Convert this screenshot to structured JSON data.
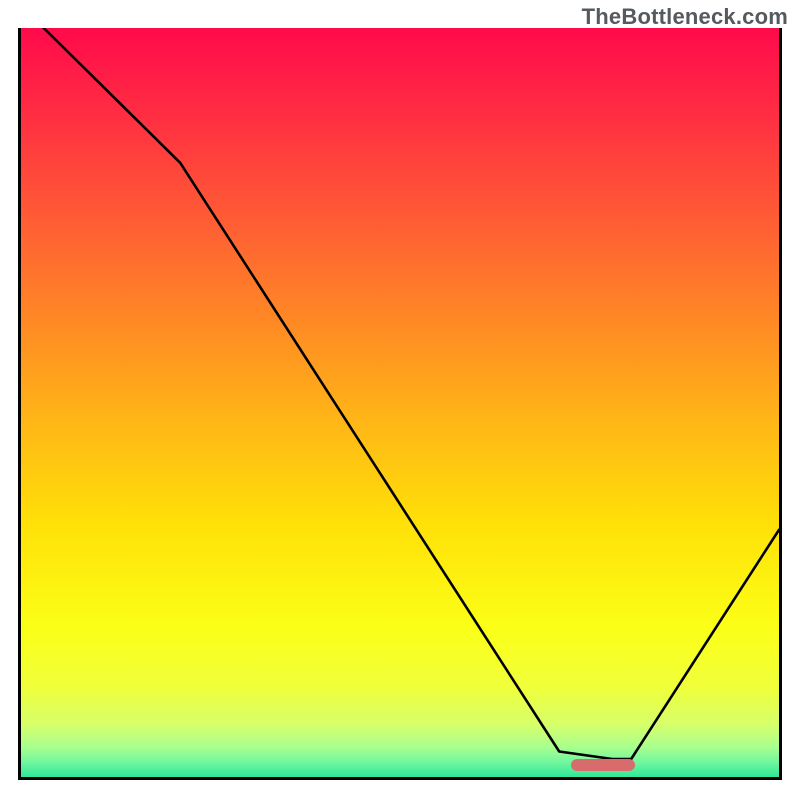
{
  "watermark": "TheBottleneck.com",
  "chart_data": {
    "type": "line",
    "title": "",
    "xlabel": "",
    "ylabel": "",
    "xlim": [
      0,
      100
    ],
    "ylim": [
      0,
      100
    ],
    "grid": false,
    "series": [
      {
        "name": "bottleneck-curve",
        "x": [
          0,
          3,
          21,
          71,
          78,
          80.5,
          100
        ],
        "y": [
          106,
          100,
          82,
          3.4,
          2.4,
          2.4,
          33
        ]
      }
    ],
    "xlim_data": [
      0,
      100
    ],
    "ylim_data": [
      0,
      100
    ],
    "gradient_stops": [
      {
        "offset": 0.0,
        "color": "#ff0a4b"
      },
      {
        "offset": 0.12,
        "color": "#ff2f42"
      },
      {
        "offset": 0.25,
        "color": "#ff5a35"
      },
      {
        "offset": 0.38,
        "color": "#ff8526"
      },
      {
        "offset": 0.52,
        "color": "#ffb417"
      },
      {
        "offset": 0.66,
        "color": "#ffe008"
      },
      {
        "offset": 0.8,
        "color": "#fbff17"
      },
      {
        "offset": 0.88,
        "color": "#f0ff3a"
      },
      {
        "offset": 0.93,
        "color": "#d6ff6a"
      },
      {
        "offset": 0.96,
        "color": "#a9ff8e"
      },
      {
        "offset": 0.98,
        "color": "#72f79e"
      },
      {
        "offset": 1.0,
        "color": "#2fe898"
      }
    ],
    "optimal_band": {
      "x_start": 72.5,
      "x_end": 81,
      "thickness_pct": 1.6
    }
  }
}
